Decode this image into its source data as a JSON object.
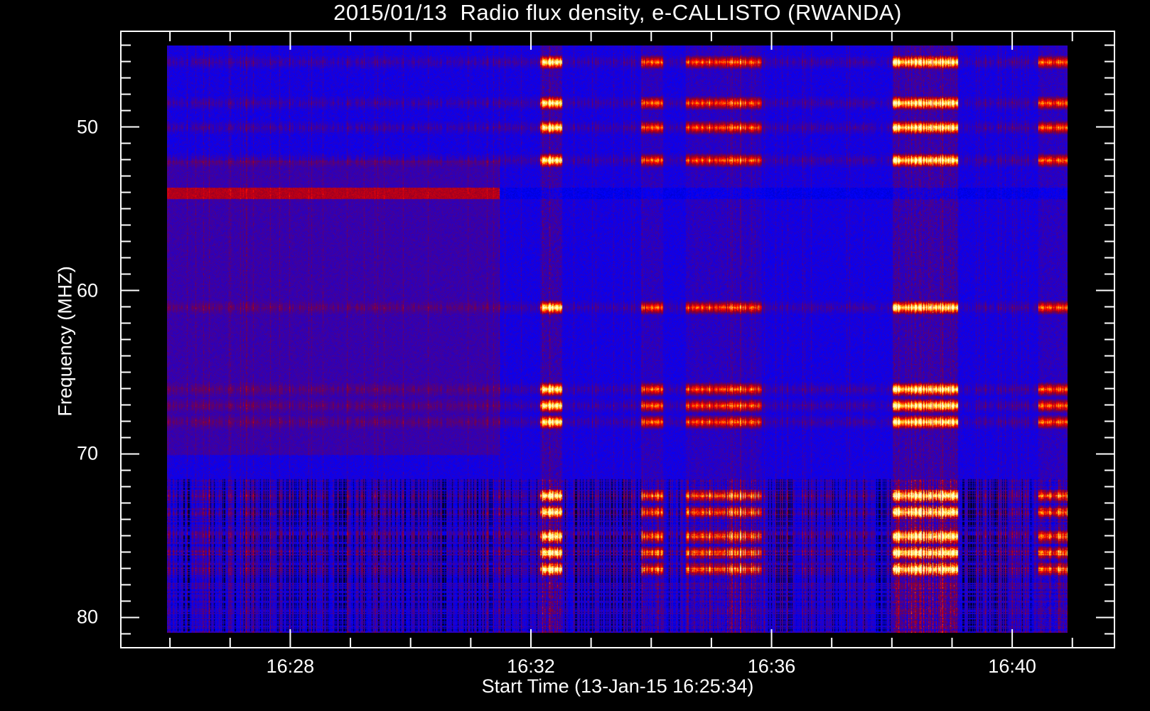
{
  "chart_data": {
    "type": "heatmap",
    "title": "2015/01/13  Radio flux density, e-CALLISTO (RWANDA)",
    "xlabel": "Start Time (13-Jan-15 16:25:34)",
    "ylabel": "Frequency (MHZ)",
    "x_ticks": [
      "16:28",
      "16:32",
      "16:36",
      "16:40"
    ],
    "x_tick_seconds": [
      1680,
      1920,
      2160,
      2400
    ],
    "x_minor_step_seconds": 60,
    "xlim_seconds_since_1600": [
      1511,
      2502
    ],
    "x_data_range_seconds_since_1600": [
      1560,
      2454
    ],
    "y_ticks": [
      "50",
      "60",
      "70",
      "80"
    ],
    "y_tick_values": [
      50,
      60,
      70,
      80
    ],
    "y_minor_step": 1,
    "ylim": [
      44.15,
      81.85
    ],
    "y_inverted": true,
    "y_data_range": [
      45,
      80.9
    ],
    "colormap": [
      "#000000",
      "#0000ff",
      "#8c0028",
      "#ff0000",
      "#ffc800",
      "#ffffc8"
    ],
    "burst_intervals_seconds": [
      [
        1930,
        1952
      ],
      [
        2030,
        2052
      ],
      [
        2075,
        2125
      ],
      [
        2110,
        2150
      ],
      [
        2280,
        2345
      ],
      [
        2425,
        2454
      ]
    ],
    "active_frequency_bands_mhz": [
      46,
      48.5,
      50,
      52,
      61,
      66,
      67,
      68,
      72.5,
      73.5,
      75,
      76,
      77
    ],
    "interference_band_mhz": 54,
    "interference_band_end_seconds": 1890
  }
}
